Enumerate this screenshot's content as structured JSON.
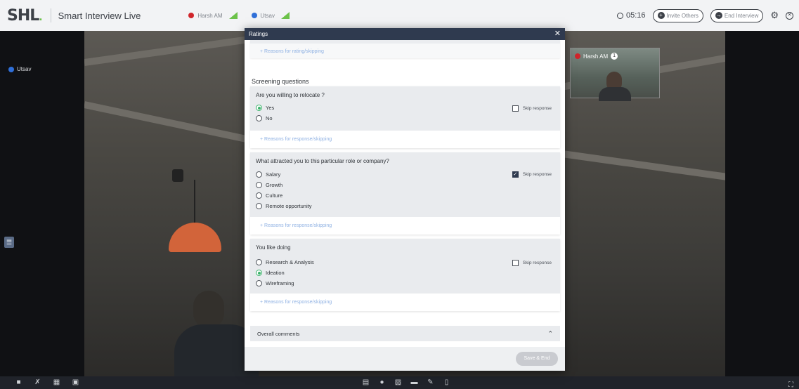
{
  "header": {
    "logo": "SHL",
    "app_title": "Smart Interview Live",
    "participants": [
      {
        "name": "Harsh AM",
        "color": "#d0252b"
      },
      {
        "name": "Utsav",
        "color": "#2f6fd8"
      }
    ],
    "timer": "05:16",
    "invite_label": "Invite Others",
    "end_label": "End Interview"
  },
  "video": {
    "main_participant": "Utsav",
    "thumb_participant": "Harsh AM",
    "thumb_badge": "1"
  },
  "modal": {
    "title": "Ratings",
    "prev_reason_link": "+ Reasons for rating/skipping",
    "section_title": "Screening questions",
    "questions": [
      {
        "title": "Are you willing to relocate ?",
        "options": [
          "Yes",
          "No"
        ],
        "selected": "Yes",
        "skip_label": "Skip response",
        "skip_checked": false,
        "reason_link": "+ Reasons for response/skipping"
      },
      {
        "title": "What attracted you to this particular role or company?",
        "options": [
          "Salary",
          "Growth",
          "Culture",
          "Remote opportunity"
        ],
        "selected": null,
        "skip_label": "Skip response",
        "skip_checked": true,
        "reason_link": "+ Reasons for response/skipping"
      },
      {
        "title": "You like doing",
        "options": [
          "Research & Analysis",
          "Ideation",
          "Wireframing"
        ],
        "selected": "Ideation",
        "skip_label": "Skip response",
        "skip_checked": false,
        "reason_link": "+ Reasons for response/skipping"
      }
    ],
    "overall_comments_label": "Overall comments",
    "save_label": "Save & End"
  },
  "bottom_bar": {
    "left_icons": [
      "camera-icon",
      "mic-off-icon",
      "grid-icon",
      "screen-share-icon"
    ],
    "center_icons": [
      "document-icon",
      "record-icon",
      "image-icon",
      "chat-icon",
      "notes-icon",
      "file-icon"
    ],
    "right_icons": [
      "fullscreen-icon"
    ]
  },
  "colors": {
    "accent_green": "#3bb36b",
    "modal_header": "#2f3a4f",
    "link_blue": "#8fb1e3"
  }
}
